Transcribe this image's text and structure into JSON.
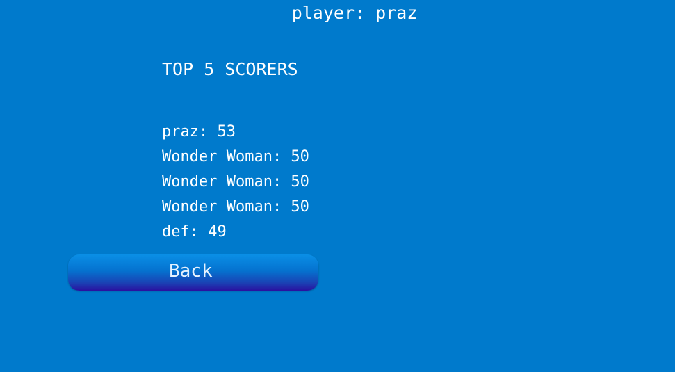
{
  "header": {
    "player_text": "player: praz"
  },
  "leaderboard": {
    "title": "TOP 5 SCORERS",
    "entries": [
      "praz: 53",
      "Wonder Woman: 50",
      "Wonder Woman: 50",
      "Wonder Woman: 50",
      "def: 49"
    ]
  },
  "actions": {
    "back_label": "Back"
  },
  "colors": {
    "background": "#007acc",
    "text": "#ffffff",
    "button_top": "#0a8fe6",
    "button_bottom": "#2a10a0"
  }
}
